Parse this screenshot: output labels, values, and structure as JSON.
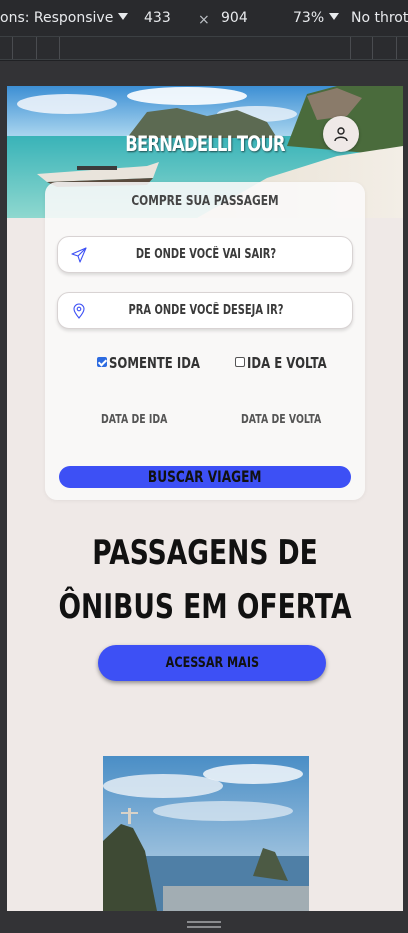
{
  "devtools": {
    "device_label": "ons: Responsive",
    "width": "433",
    "times": "×",
    "height": "904",
    "zoom": "73%",
    "throttle": "No thrott"
  },
  "site": {
    "brand": "BERNADELLI TOUR",
    "card_title": "COMPRE SUA PASSAGEM",
    "origin_placeholder": "DE ONDE VOCÊ VAI SAIR?",
    "destination_placeholder": "PRA ONDE VOCÊ DESEJA IR?",
    "one_way_label": "SOMENTE IDA",
    "one_way_checked": true,
    "round_trip_label": "IDA E VOLTA",
    "round_trip_checked": false,
    "departure_label": "DATA DE IDA",
    "return_label": "DATA DE VOLTA",
    "search_button": "BUSCAR VIAGEM",
    "offers_title": "PASSAGENS DE ÔNIBUS EM OFERTA",
    "more_button": "ACESSAR MAIS"
  },
  "icons": {
    "origin": "send-icon",
    "destination": "map-pin-icon",
    "user": "user-icon"
  },
  "colors": {
    "accent": "#3d50f5",
    "page_bg": "#efe9e7"
  }
}
